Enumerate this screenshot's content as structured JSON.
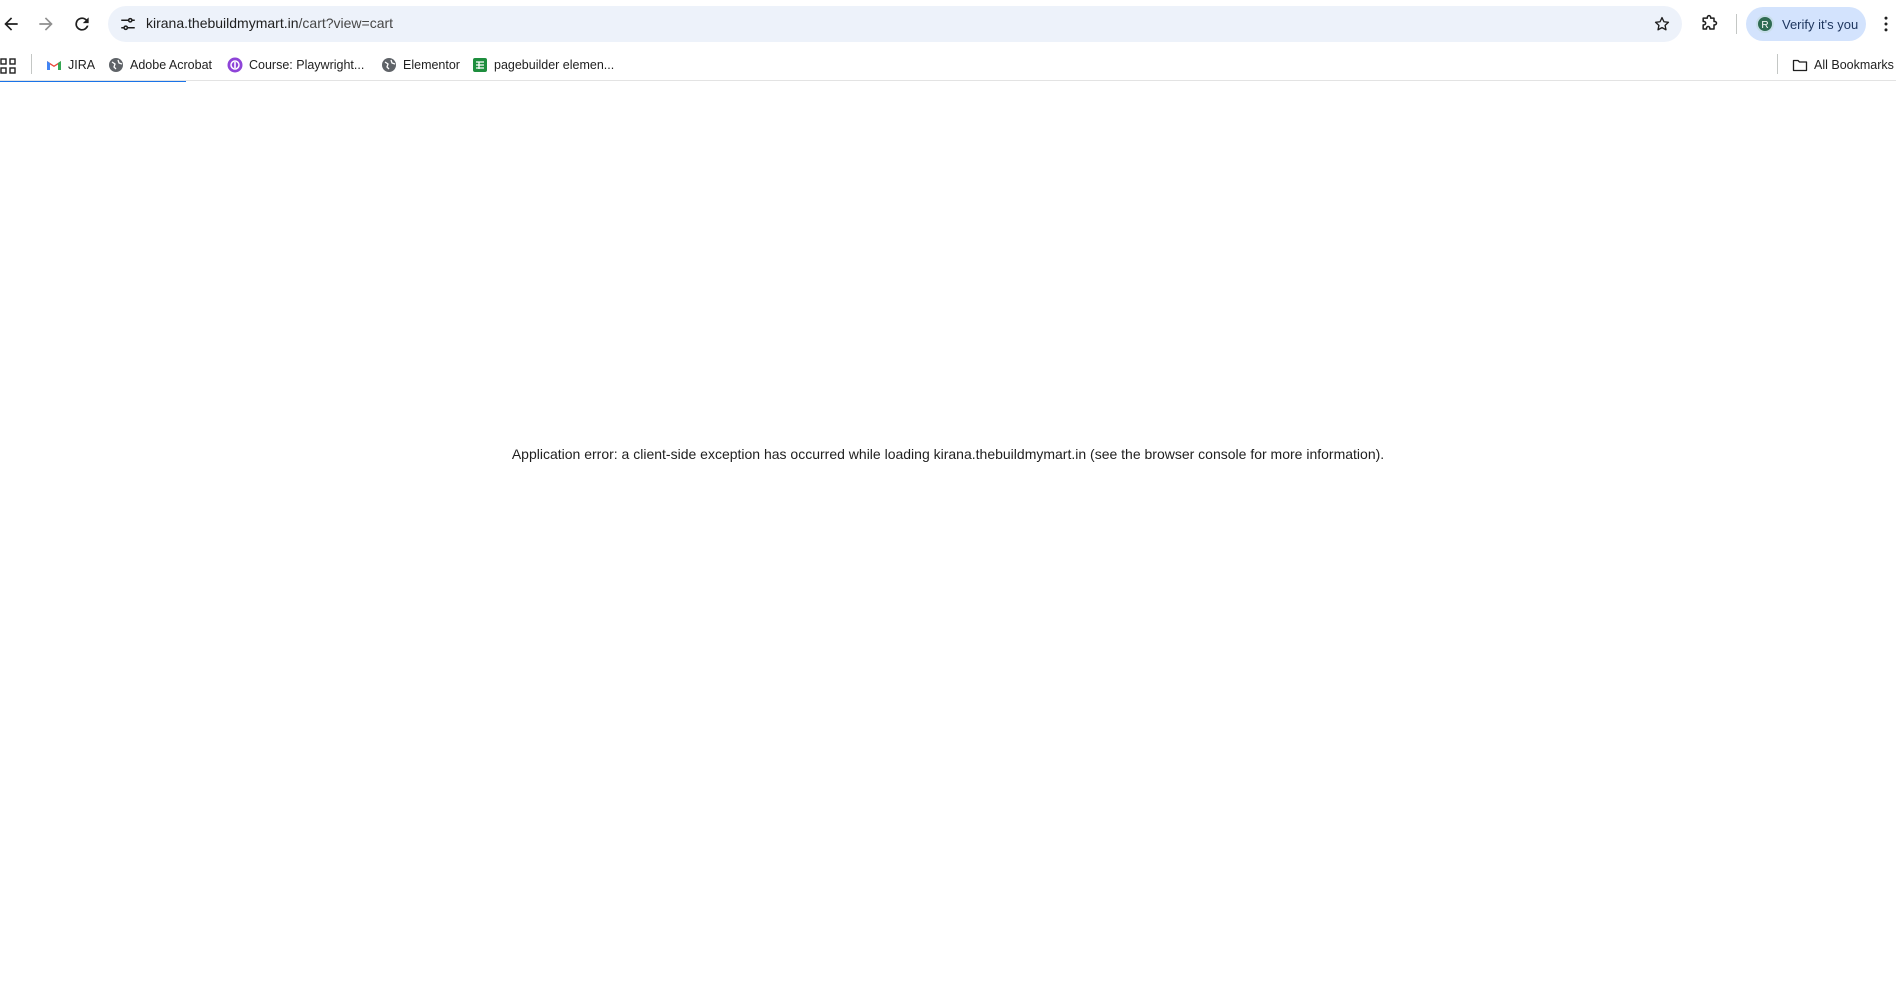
{
  "browser": {
    "url_host": "kirana.thebuildmymart.in",
    "url_path": "/cart?view=cart",
    "profile_button": "Verify it's you",
    "profile_initial": "R"
  },
  "bookmarks": {
    "items": [
      {
        "label": "JIRA",
        "icon": "gmail-icon"
      },
      {
        "label": "Adobe Acrobat",
        "icon": "globe-icon"
      },
      {
        "label": "Course: Playwright...",
        "icon": "course-icon"
      },
      {
        "label": "Elementor",
        "icon": "globe-icon"
      },
      {
        "label": "pagebuilder elemen...",
        "icon": "sheets-icon"
      }
    ],
    "all_bookmarks": "All Bookmarks"
  },
  "page": {
    "error_message": "Application error: a client-side exception has occurred while loading kirana.thebuildmymart.in (see the browser console for more information)."
  },
  "colors": {
    "omnibox_bg": "#edf2fa",
    "verify_bg": "#d3e3fd",
    "loading_bar": "#1a73e8"
  }
}
